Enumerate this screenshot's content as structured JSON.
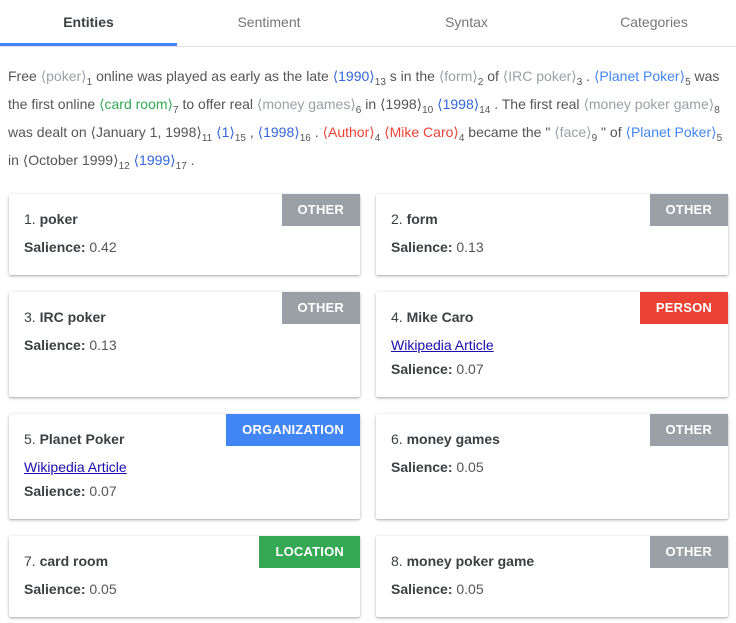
{
  "tabs": [
    "Entities",
    "Sentiment",
    "Syntax",
    "Categories"
  ],
  "text": {
    "s1": "Free ",
    "e_poker": "⟨poker⟩",
    "n_poker": "1",
    "s2": " online was played as early as the late ",
    "e_1990": "⟨1990⟩",
    "n_1990": "13",
    "s3": " s in the ",
    "e_form": "⟨form⟩",
    "n_form": "2",
    "s4": " of ",
    "e_irc": "⟨IRC poker⟩",
    "n_irc": "3",
    "s5": " . ",
    "e_planet1": "⟨Planet Poker⟩",
    "n_planet1": "5",
    "s6": " was the first online ",
    "e_cardroom": "⟨card room⟩",
    "n_cardroom": "7",
    "s7": " to offer real ",
    "e_moneygames": "⟨money games⟩",
    "n_moneygames": "6",
    "s8": " in ",
    "e_1998a": "⟨1998⟩",
    "n_1998a": "10",
    "s9": " ",
    "e_1998b": "⟨1998⟩",
    "n_1998b": "14",
    "s10": " . The first real ",
    "e_mpg": "⟨money poker game⟩",
    "n_mpg": "8",
    "s11": " was dealt on ",
    "e_jan": "⟨January 1, 1998⟩",
    "n_jan": "11",
    "s12": " ",
    "e_1": "⟨1⟩",
    "n_1": "15",
    "s13": " , ",
    "e_1998c": "⟨1998⟩",
    "n_1998c": "16",
    "s14": " . ",
    "e_author": "⟨Author⟩",
    "n_author": "4",
    "s15": " ",
    "e_caro": "⟨Mike Caro⟩",
    "n_caro": "4",
    "s16": " became the \" ",
    "e_face": "⟨face⟩",
    "n_face": "9",
    "s17": " \" of ",
    "e_planet2": "⟨Planet Poker⟩",
    "n_planet2": "5",
    "s18": " in ",
    "e_oct": "⟨October 1999⟩",
    "n_oct": "12",
    "s19": " ",
    "e_1999": "⟨1999⟩",
    "n_1999": "17",
    "s20": " ."
  },
  "labels": {
    "salience": "Salience:",
    "wiki": "Wikipedia Article"
  },
  "cards": [
    {
      "num": "1. ",
      "name": "poker",
      "type": "OTHER",
      "salience": "0.42"
    },
    {
      "num": "2. ",
      "name": "form",
      "type": "OTHER",
      "salience": "0.13"
    },
    {
      "num": "3. ",
      "name": "IRC poker",
      "type": "OTHER",
      "salience": "0.13"
    },
    {
      "num": "4. ",
      "name": "Mike Caro",
      "type": "PERSON",
      "salience": "0.07"
    },
    {
      "num": "5. ",
      "name": "Planet Poker",
      "type": "ORGANIZATION",
      "salience": "0.07"
    },
    {
      "num": "6. ",
      "name": "money games",
      "type": "OTHER",
      "salience": "0.05"
    },
    {
      "num": "7. ",
      "name": "card room",
      "type": "LOCATION",
      "salience": "0.05"
    },
    {
      "num": "8. ",
      "name": "money poker game",
      "type": "OTHER",
      "salience": "0.05"
    }
  ],
  "colors": {
    "accent": "#4285f4",
    "other": "#9aa0a6",
    "person": "#ea4335",
    "organization": "#4285f4",
    "location": "#34a853"
  }
}
